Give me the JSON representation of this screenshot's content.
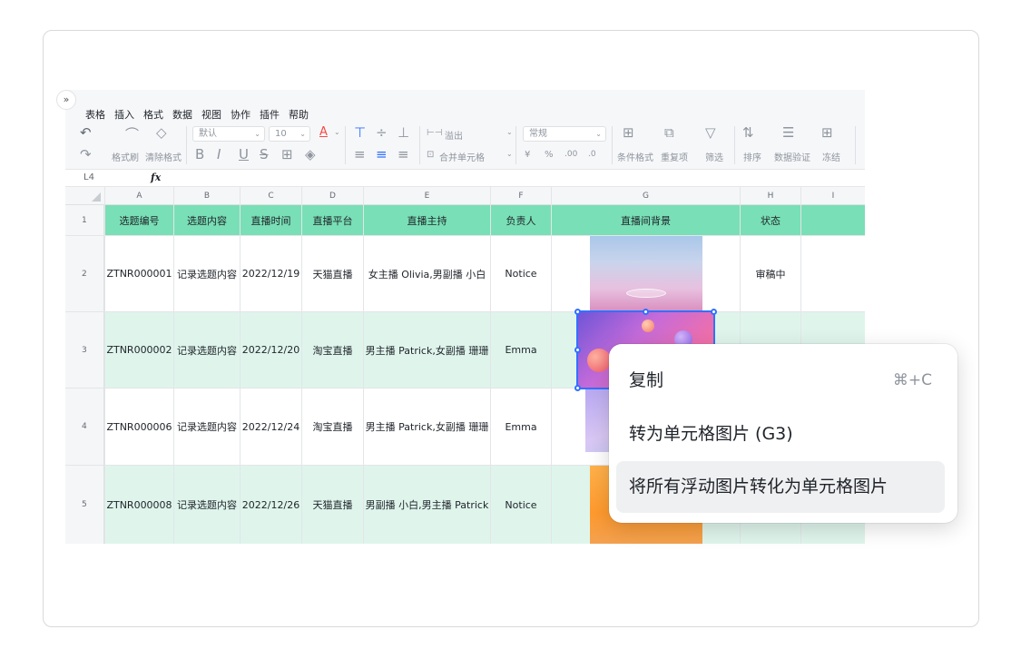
{
  "menu_bar": [
    "表格",
    "插入",
    "格式",
    "数据",
    "视图",
    "协作",
    "插件",
    "帮助"
  ],
  "toolbar": {
    "format_painter": "格式刷",
    "clear_format": "清除格式",
    "font_name": "默认",
    "font_size": "10",
    "bold": "B",
    "italic": "I",
    "underline": "U",
    "strike": "S",
    "font_color": "A",
    "overflow": "溢出",
    "merge": "合并单元格",
    "number_format": "常规",
    "currency": "¥",
    "percent": "%",
    "dec_inc": ".00",
    "dec_dec": ".0",
    "cond_format": "条件格式",
    "duplicates": "重复项",
    "filter": "筛选",
    "sort": "排序",
    "validation": "数据验证",
    "freeze": "冻结"
  },
  "formula_bar": {
    "cell_ref": "L4",
    "fx": "fx"
  },
  "columns": [
    "A",
    "B",
    "C",
    "D",
    "E",
    "F",
    "G",
    "H",
    "I"
  ],
  "header_row": {
    "num": "1",
    "cells": [
      "选题编号",
      "选题内容",
      "直播时间",
      "直播平台",
      "直播主持",
      "负责人",
      "直播间背景",
      "状态",
      ""
    ]
  },
  "rows": [
    {
      "num": "2",
      "cells": [
        "ZTNR000001",
        "记录选题内容",
        "2022/12/19",
        "天猫直播",
        "女主播 Olivia,男副播 小白",
        "Notice",
        "",
        "审稿中",
        ""
      ]
    },
    {
      "num": "3",
      "cells": [
        "ZTNR000002",
        "记录选题内容",
        "2022/12/20",
        "淘宝直播",
        "男主播 Patrick,女副播 珊珊",
        "Emma",
        "",
        "",
        ""
      ]
    },
    {
      "num": "4",
      "cells": [
        "ZTNR000006",
        "记录选题内容",
        "2022/12/24",
        "淘宝直播",
        "男主播 Patrick,女副播 珊珊",
        "Emma",
        "",
        "",
        ""
      ]
    },
    {
      "num": "5",
      "cells": [
        "ZTNR000008",
        "记录选题内容",
        "2022/12/26",
        "天猫直播",
        "男副播 小白,男主播 Patrick",
        "Notice",
        "",
        "",
        ""
      ]
    }
  ],
  "context_menu": {
    "copy": "复制",
    "copy_shortcut": "⌘+C",
    "to_cell_image": "转为单元格图片 (G3)",
    "all_to_cell_images": "将所有浮动图片转化为单元格图片"
  },
  "colors": {
    "header_green": "#79dfb6",
    "row_green": "#dff5ec",
    "selection": "#3370ff"
  }
}
